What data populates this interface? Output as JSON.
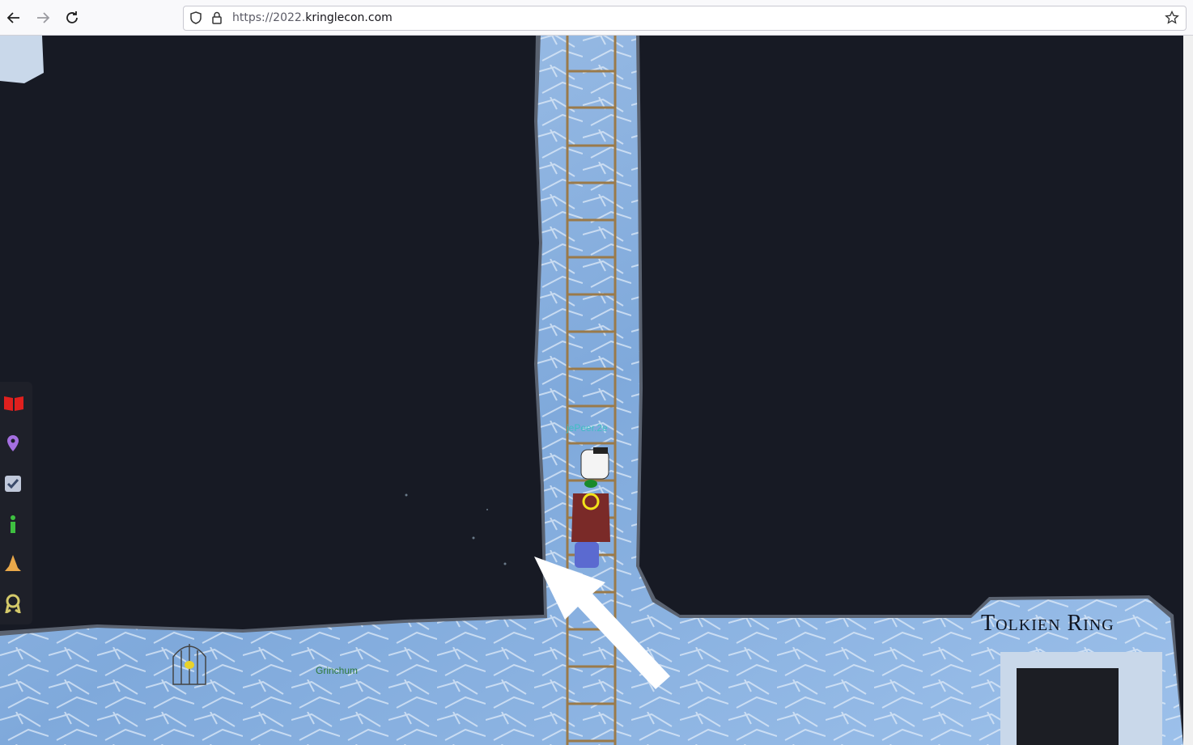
{
  "browser": {
    "url_prefix": "https://2022.",
    "url_host": "kringlecon.com"
  },
  "game": {
    "player_name": "jePeer.2e",
    "npc_name": "Grinchum",
    "area_title": "Tolkien Ring"
  },
  "sidebar": {
    "icons": [
      "book-icon",
      "map-pin-icon",
      "checkbox-icon",
      "info-icon",
      "hat-icon",
      "badge-icon"
    ]
  },
  "colors": {
    "background": "#171a24",
    "ice": "#8fb5e0",
    "ladder": "#9a7a4a",
    "player_name": "#3fbfc4",
    "npc_name": "#2f7a3a"
  }
}
